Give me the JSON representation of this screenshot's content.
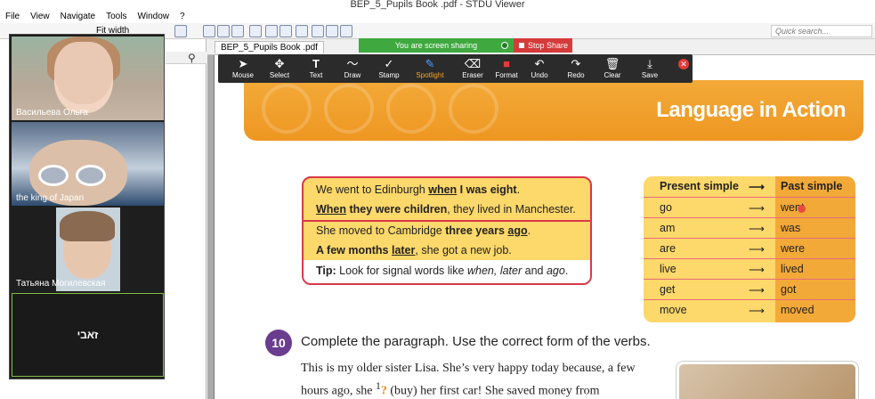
{
  "window": {
    "title": "BEP_5_Pupils Book .pdf - STDU Viewer"
  },
  "menu": [
    "File",
    "View",
    "Navigate",
    "Tools",
    "Window",
    "?"
  ],
  "toolbar": {
    "zoom_label": "Fit width",
    "search_placeholder": "Quick search..."
  },
  "participants": [
    {
      "name": "Васильева Ольга"
    },
    {
      "name": "the king of Japan"
    },
    {
      "name": "Татьяна Могилевская"
    },
    {
      "name": "זאבי"
    }
  ],
  "doc_tab": "BEP_5_Pupils Book .pdf",
  "sharing": {
    "banner": "You are screen sharing",
    "stop_label": "Stop Share"
  },
  "annotate": {
    "tools": [
      {
        "label": "Mouse",
        "glyph": "➤",
        "icon": "mouse-pointer-icon"
      },
      {
        "label": "Select",
        "glyph": "✥",
        "icon": "select-move-icon"
      },
      {
        "label": "Text",
        "glyph": "T",
        "icon": "text-icon"
      },
      {
        "label": "Draw",
        "glyph": "〜",
        "icon": "draw-icon"
      },
      {
        "label": "Stamp",
        "glyph": "✓",
        "icon": "stamp-icon"
      },
      {
        "label": "Spotlight",
        "glyph": "✎",
        "icon": "spotlight-icon"
      },
      {
        "label": "Eraser",
        "glyph": "⌫",
        "icon": "eraser-icon"
      },
      {
        "label": "Format",
        "glyph": "■",
        "icon": "format-icon"
      },
      {
        "label": "Undo",
        "glyph": "↶",
        "icon": "undo-icon"
      },
      {
        "label": "Redo",
        "glyph": "↷",
        "icon": "redo-icon"
      },
      {
        "label": "Clear",
        "glyph": "🗑",
        "icon": "trash-icon"
      },
      {
        "label": "Save",
        "glyph": "⤓",
        "icon": "save-icon"
      }
    ],
    "active": "Spotlight"
  },
  "page": {
    "banner_title": "Language in Action",
    "grammar": {
      "l1_a": "We went to Edinburgh ",
      "l1_b": "when",
      "l1_c": " I was eight",
      "l1_d": ".",
      "l2_a": "When",
      "l2_b": " they were children",
      "l2_c": ", they lived in Manchester.",
      "l3_a": "She moved to Cambridge ",
      "l3_b": "three years ",
      "l3_c": "ago",
      "l3_d": ".",
      "l4_a": "A few months ",
      "l4_b": "later",
      "l4_c": ", she got a new job.",
      "tip_label": "Tip:",
      "tip_a": " Look for signal words like ",
      "tip_b": "when, later",
      "tip_c": " and ",
      "tip_d": "ago",
      "tip_e": "."
    },
    "tenses": {
      "head_present": "Present simple",
      "head_past": "Past simple",
      "arrow": "⟶",
      "rows": [
        {
          "present": "go",
          "past": "went"
        },
        {
          "present": "am",
          "past": "was"
        },
        {
          "present": "are",
          "past": "were"
        },
        {
          "present": "live",
          "past": "lived"
        },
        {
          "present": "get",
          "past": "got"
        },
        {
          "present": "move",
          "past": "moved"
        }
      ]
    },
    "exercise": {
      "number": "10",
      "title": "Complete the paragraph. Use the correct form of the verbs.",
      "p1": "This is my older sister Lisa. She’s very happy today because, a few hours ago, she ",
      "sup1": "1",
      "q1": "?",
      "p2": " (buy) her first car! She saved money from"
    }
  }
}
